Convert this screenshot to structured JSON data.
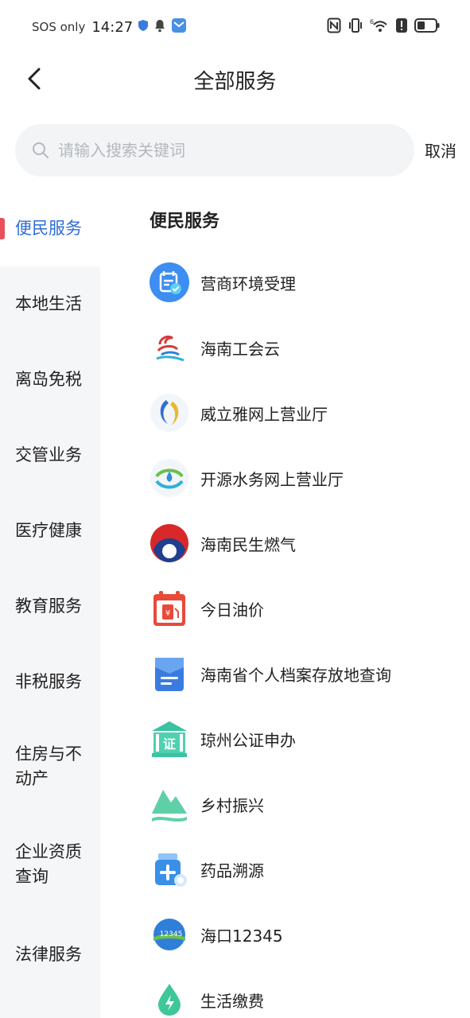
{
  "status_bar": {
    "carrier": "SOS only",
    "time": "14:27",
    "signal_label": "6"
  },
  "header": {
    "title": "全部服务"
  },
  "search": {
    "placeholder": "请输入搜索关键词",
    "value": "",
    "cancel_label": "取消"
  },
  "sidebar": {
    "items": [
      {
        "label": "便民服务",
        "active": true
      },
      {
        "label": "本地生活"
      },
      {
        "label": "离岛免税"
      },
      {
        "label": "交管业务"
      },
      {
        "label": "医疗健康"
      },
      {
        "label": "教育服务"
      },
      {
        "label": "非税服务"
      },
      {
        "label": "住房与不\n动产"
      },
      {
        "label": "企业资质\n查询"
      },
      {
        "label": "法律服务"
      }
    ]
  },
  "content": {
    "section_title": "便民服务",
    "services": [
      {
        "label": "营商环境受理",
        "icon": "business-calendar-icon"
      },
      {
        "label": "海南工会云",
        "icon": "trade-union-cloud-icon"
      },
      {
        "label": "威立雅网上营业厅",
        "icon": "veolia-logo-icon"
      },
      {
        "label": "开源水务网上营业厅",
        "icon": "water-drop-logo-icon"
      },
      {
        "label": "海南民生燃气",
        "icon": "gas-logo-icon"
      },
      {
        "label": "今日油价",
        "icon": "fuel-calendar-icon"
      },
      {
        "label": "海南省个人档案存放地查询",
        "icon": "archive-folder-icon"
      },
      {
        "label": "琼州公证申办",
        "icon": "notary-building-icon"
      },
      {
        "label": "乡村振兴",
        "icon": "mountain-icon"
      },
      {
        "label": "药品溯源",
        "icon": "medicine-bottle-icon"
      },
      {
        "label": "海口12345",
        "icon": "haikou-12345-icon"
      },
      {
        "label": "生活缴费",
        "icon": "utility-payment-icon"
      }
    ]
  },
  "colors": {
    "accent": "#2f6ed6",
    "active_marker": "#e8505b",
    "sidebar_bg": "#f5f6f8",
    "search_bg": "#f3f4f6"
  }
}
